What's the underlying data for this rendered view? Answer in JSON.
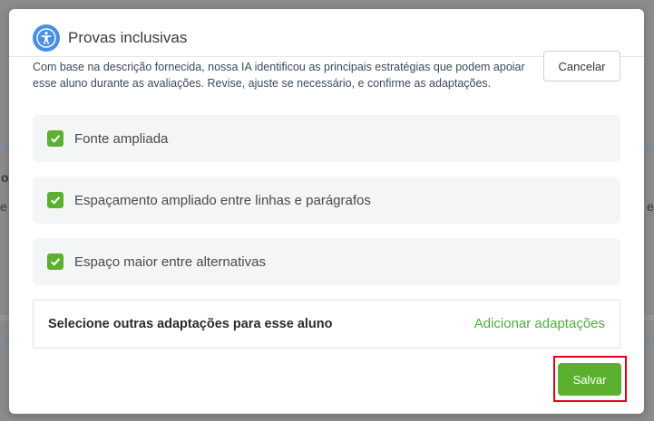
{
  "background": {
    "fragments": [
      "o",
      "e",
      "e"
    ]
  },
  "modal": {
    "icon": "accessibility-icon",
    "title": "Provas inclusivas",
    "description": "Com base na descrição fornecida, nossa IA identificou as principais estratégias que podem apoiar esse aluno durante as avaliações. Revise, ajuste se necessário, e confirme as adaptações.",
    "cancel_label": "Cancelar",
    "options": [
      {
        "label": "Fonte ampliada",
        "checked": true
      },
      {
        "label": "Espaçamento ampliado entre linhas e parágrafos",
        "checked": true
      },
      {
        "label": "Espaço maior entre alternativas",
        "checked": true
      }
    ],
    "other_adaptations": {
      "title": "Selecione outras adaptações para esse aluno",
      "link": "Adicionar adaptações"
    },
    "save_label": "Salvar"
  },
  "colors": {
    "accent_green": "#5cb030",
    "link_green": "#4cae3e",
    "icon_blue": "#4a90e2",
    "highlight_red": "#e0001a"
  }
}
